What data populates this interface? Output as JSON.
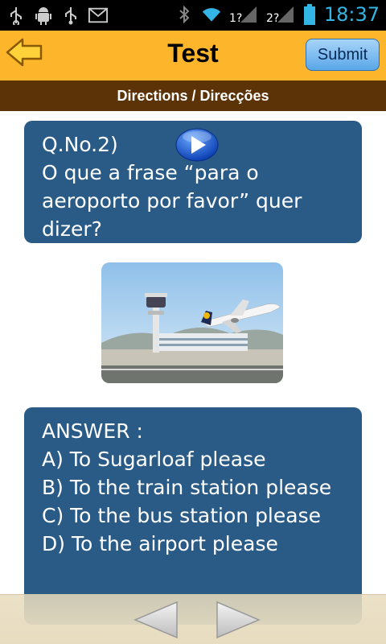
{
  "status_bar": {
    "time": "18:37",
    "icons": [
      "usb-icon",
      "android-debug-icon",
      "usb-icon",
      "gmail-icon",
      "bluetooth-icon",
      "wifi-icon",
      "signal-sim1-icon",
      "signal-sim2-icon",
      "battery-icon"
    ],
    "sim1_label": "1?",
    "sim2_label": "2?"
  },
  "header": {
    "title": "Test",
    "submit_label": "Submit",
    "accent_color": "#fdb62c"
  },
  "directions": {
    "label": "Directions / Direcções",
    "bar_color": "#5c3307"
  },
  "question": {
    "number": "Q.No.2)",
    "text": "O que a frase “para o aeroporto por favor” quer dizer?",
    "card_color": "#2a5b87"
  },
  "answer": {
    "heading": "ANSWER :",
    "options": [
      "A) To Sugarloaf please",
      "B) To the train station please",
      "C) To the bus station please",
      "D) To the airport please"
    ]
  }
}
